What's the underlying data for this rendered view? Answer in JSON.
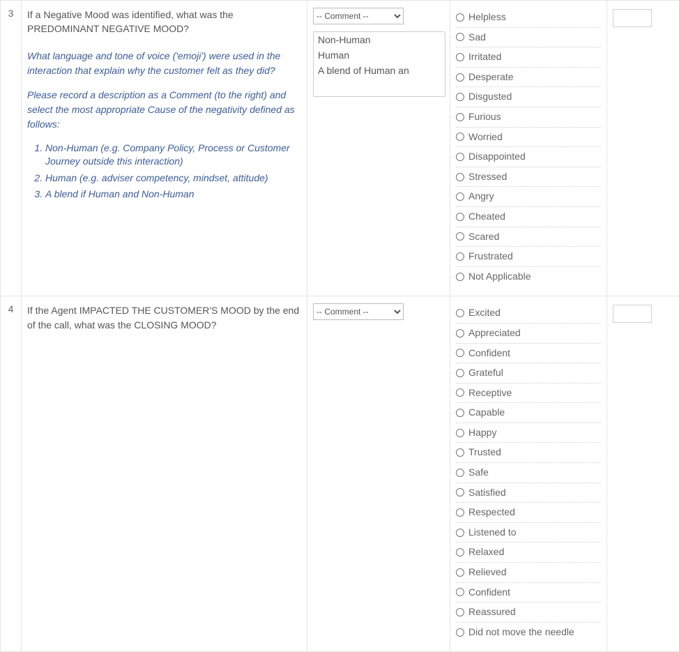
{
  "comment_placeholder": "-- Comment --",
  "rows": [
    {
      "num": "3",
      "question": "If a Negative Mood was identified, what was the PREDOMINANT NEGATIVE MOOD?",
      "hint1": "What language and tone of voice ('emoji') were used in the interaction that explain why the customer felt as they did?",
      "hint2": "Please record a description as a Comment (to the right) and select the most appropriate Cause of the negativity defined as follows:",
      "causes": [
        "Non-Human (e.g. Company Policy, Process or Customer Journey outside this interaction)",
        "Human (e.g. adviser competency, mindset, attitude)",
        "A blend if Human and Non-Human"
      ],
      "listbox": [
        "Non-Human",
        "Human",
        "A blend of Human an"
      ],
      "options": [
        "Helpless",
        "Sad",
        "Irritated",
        "Desperate",
        "Disgusted",
        "Furious",
        "Worried",
        "Disappointed",
        "Stressed",
        "Angry",
        "Cheated",
        "Scared",
        "Frustrated",
        "Not Applicable"
      ]
    },
    {
      "num": "4",
      "question": "If the Agent IMPACTED THE CUSTOMER'S MOOD by the end of the call, what was the CLOSING MOOD?",
      "options": [
        "Excited",
        "Appreciated",
        "Confident",
        "Grateful",
        "Receptive",
        "Capable",
        "Happy",
        "Trusted",
        "Safe",
        "Satisfied",
        "Respected",
        "Listened to",
        "Relaxed",
        "Relieved",
        "Confident",
        "Reassured",
        "Did not move the needle"
      ]
    }
  ]
}
